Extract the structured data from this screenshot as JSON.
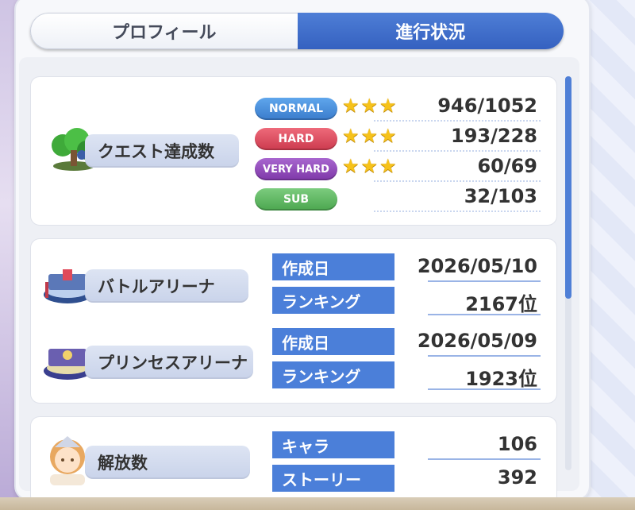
{
  "tabs": {
    "profile": "プロフィール",
    "progress": "進行状況"
  },
  "quest": {
    "label": "クエスト達成数",
    "icon": "tree-icon",
    "rows": [
      {
        "badge": "NORMAL",
        "color": "#3f86d8",
        "stars": 3,
        "value": "946/1052"
      },
      {
        "badge": "HARD",
        "color": "#d9465a",
        "stars": 3,
        "value": "193/228"
      },
      {
        "badge": "VERY HARD",
        "color": "#8e45b6",
        "stars": 3,
        "value": "60/69"
      },
      {
        "badge": "SUB",
        "color": "#5cb860",
        "stars": 0,
        "value": "32/103"
      }
    ]
  },
  "arena": {
    "battle_label": "バトルアリーナ",
    "princess_label": "プリンセスアリーナ",
    "battle_created_label": "作成日",
    "battle_created": "2026/05/10",
    "battle_rank_label": "ランキング",
    "battle_rank": "2167位",
    "princess_created_label": "作成日",
    "princess_created": "2026/05/09",
    "princess_rank_label": "ランキング",
    "princess_rank": "1923位"
  },
  "unlock": {
    "label": "解放数",
    "chara_label": "キャラ",
    "chara": "106",
    "story_label": "ストーリー",
    "story": "392"
  },
  "colors": {
    "accent": "#4b7fd9",
    "tab_active": "#3f6fcf",
    "star": "#f6c21a"
  }
}
